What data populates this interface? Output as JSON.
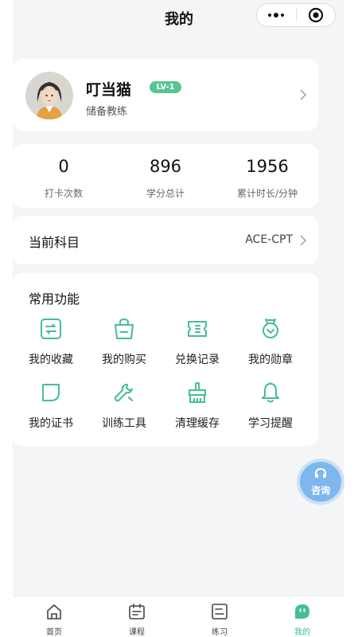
{
  "header": {
    "title": "我的"
  },
  "profile": {
    "name": "叮当猫",
    "level": "LV-1",
    "role": "储备教练"
  },
  "stats": [
    {
      "value": "0",
      "label": "打卡次数"
    },
    {
      "value": "896",
      "label": "学分总计"
    },
    {
      "value": "1956",
      "label": "累计时长/分钟"
    }
  ],
  "subject": {
    "label": "当前科目",
    "value": "ACE-CPT"
  },
  "features": {
    "title": "常用功能",
    "items": [
      {
        "label": "我的收藏",
        "icon": "favorites-icon"
      },
      {
        "label": "我的购买",
        "icon": "purchase-bag-icon"
      },
      {
        "label": "兑换记录",
        "icon": "ticket-icon"
      },
      {
        "label": "我的勋章",
        "icon": "medal-icon"
      },
      {
        "label": "我的证书",
        "icon": "certificate-icon"
      },
      {
        "label": "训练工具",
        "icon": "wrench-icon"
      },
      {
        "label": "清理缓存",
        "icon": "broom-icon"
      },
      {
        "label": "学习提醒",
        "icon": "bell-icon"
      }
    ]
  },
  "consult": {
    "label": "咨询"
  },
  "tabbar": {
    "items": [
      {
        "label": "首页",
        "icon": "home-icon"
      },
      {
        "label": "课程",
        "icon": "calendar-icon"
      },
      {
        "label": "练习",
        "icon": "practice-icon"
      },
      {
        "label": "我的",
        "icon": "mine-icon",
        "active": true
      }
    ]
  },
  "colors": {
    "accent": "#56c493",
    "page_bg": "#f4f5f7",
    "card_bg": "#ffffff",
    "consult_bg": "#7db7ee"
  }
}
